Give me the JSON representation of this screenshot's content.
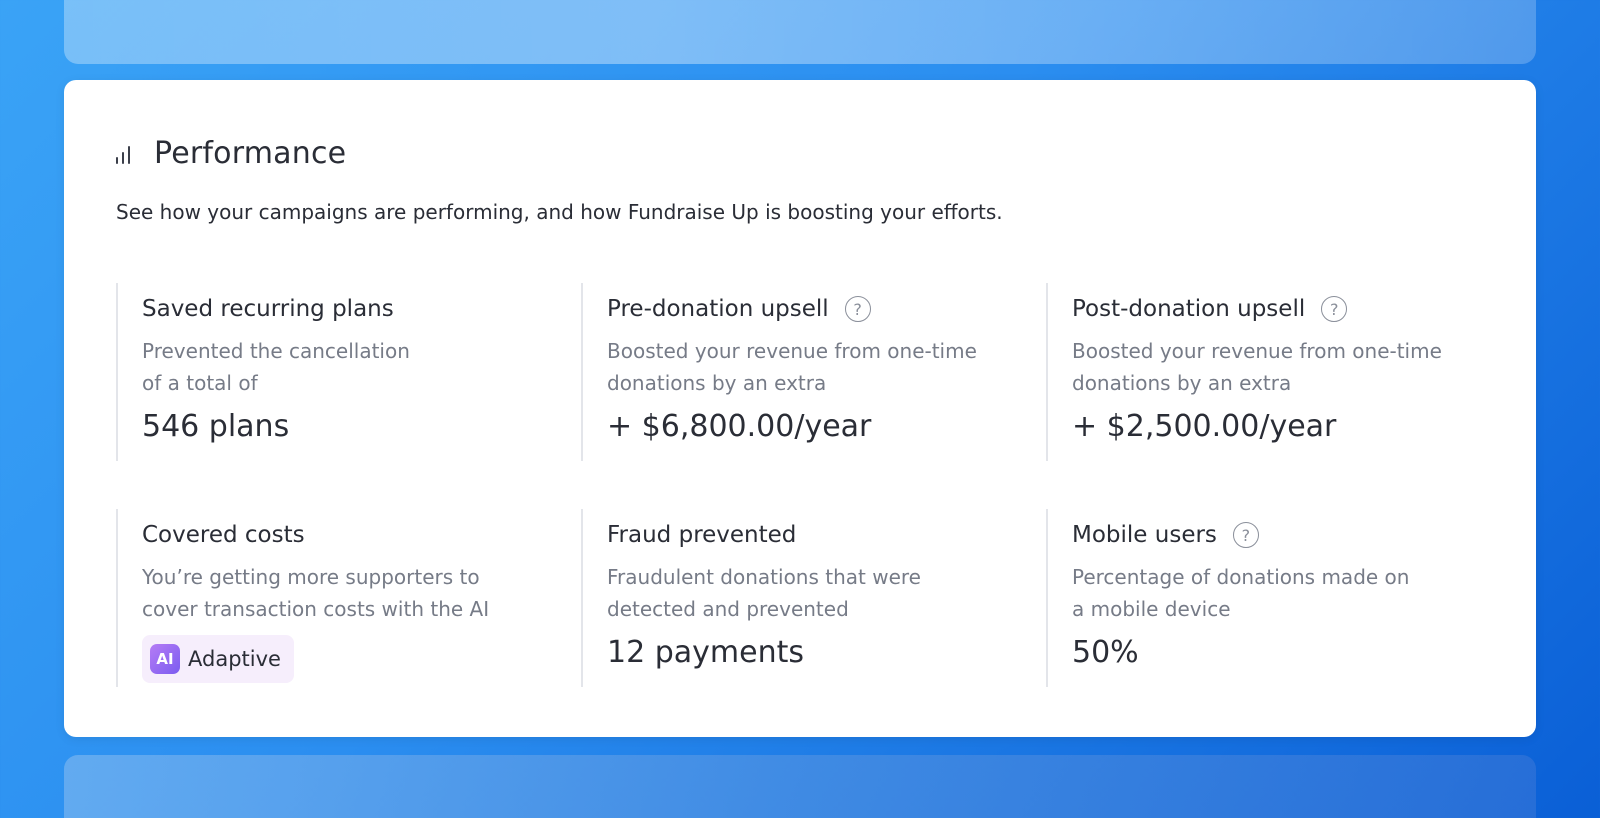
{
  "colors": {
    "background_start": "#3aa3f6",
    "background_end": "#0a5fd6",
    "card": "#ffffff",
    "text_primary": "#2a2d36",
    "text_secondary": "#767b87",
    "ai_badge": "#b57cf5"
  },
  "section": {
    "icon": "bar-chart-icon",
    "title": "Performance",
    "subtitle": "See how your campaigns are performing, and how Fundraise Up is boosting your efforts."
  },
  "metrics": [
    {
      "title": "Saved recurring plans",
      "desc_line1": "Prevented the cancellation",
      "desc_line2": "of a total of",
      "value": "546 plans",
      "help": false
    },
    {
      "title": "Pre-donation upsell",
      "desc_line1": "Boosted your revenue from one-time",
      "desc_line2": "donations by an extra",
      "value": "+ $6,800.00/year",
      "help": true
    },
    {
      "title": "Post-donation upsell",
      "desc_line1": "Boosted your revenue from one-time",
      "desc_line2": "donations by an extra",
      "value": "+ $2,500.00/year",
      "help": true
    },
    {
      "title": "Covered costs",
      "desc_line1": "You’re getting more supporters to",
      "desc_line2": "cover transaction costs with the AI",
      "badge_icon": "AI",
      "badge_label": "Adaptive",
      "help": false
    },
    {
      "title": "Fraud prevented",
      "desc_line1": "Fraudulent donations that were",
      "desc_line2": "detected and prevented",
      "value": "12 payments",
      "help": false
    },
    {
      "title": "Mobile users",
      "desc_line1": "Percentage of donations made on",
      "desc_line2": "a mobile device",
      "value": "50%",
      "help": true
    }
  ],
  "help_glyph": "?"
}
